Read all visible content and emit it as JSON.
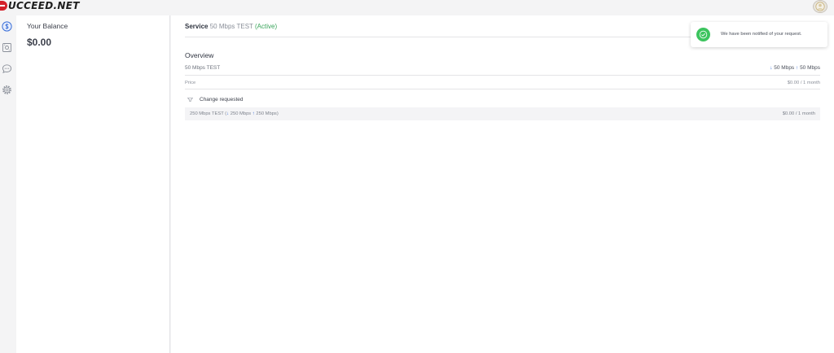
{
  "brand": {
    "logo_text": "UCCEED.NET",
    "logo_color": "#d4202a"
  },
  "sidebar": {
    "icons": [
      "dollar-circle-icon",
      "money-bill-icon",
      "chat-bubble-icon",
      "gear-icon"
    ],
    "active_color": "#3a6fd8"
  },
  "balance": {
    "label": "Your Balance",
    "value": "$0.00"
  },
  "service": {
    "label": "Service",
    "name": "50 Mbps TEST",
    "status": "(Active)",
    "status_color": "#3aa55b"
  },
  "overview": {
    "title": "Overview",
    "plan_name": "50 Mbps TEST",
    "speed_down": "50 Mbps",
    "speed_up": "50 Mbps",
    "price_label": "Price",
    "price_value": "$0.00 / 1 month"
  },
  "change": {
    "heading": "Change requested",
    "plan_prefix": "250 Mbps TEST (",
    "speed_down": "250 Mbps",
    "speed_up": "250 Mbps",
    "plan_suffix": ")",
    "price": "$0.00 / 1 month"
  },
  "toast": {
    "message": "We have been notified of your request.",
    "icon": "check-circle-icon",
    "color": "#3cc45e"
  },
  "user": {
    "avatar_icon": "user-avatar-icon"
  }
}
